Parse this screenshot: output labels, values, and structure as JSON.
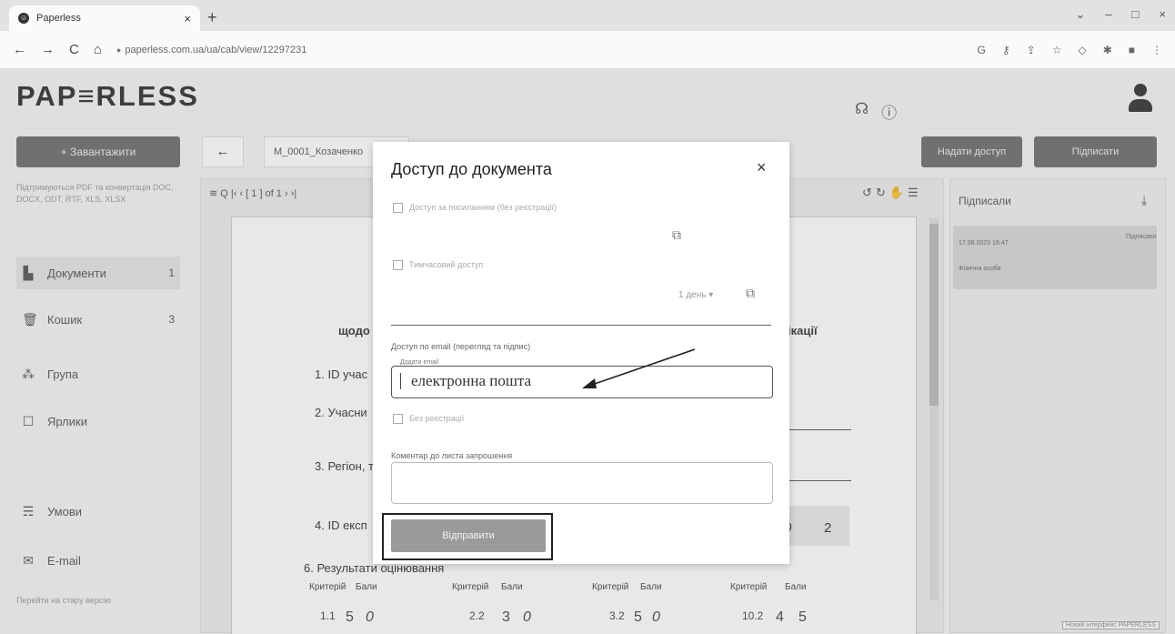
{
  "browser": {
    "tab_title": "Paperless",
    "tab_favicon": "paperless-favicon",
    "tab_close": "×",
    "new_tab": "+",
    "url": "paperless.com.ua/ua/cab/view/12297231",
    "nav": {
      "back": "←",
      "forward": "→",
      "reload": "C",
      "home": "⌂"
    },
    "window_controls": [
      "⌄",
      "–",
      "□",
      "×"
    ]
  },
  "app": {
    "logo": "PAP≡RLESS",
    "upload_button": "+ Завантажити",
    "upload_hint": "Підтримуються PDF та конвертація DOC, DOCX, ODT, RTF, XLS, XLSX",
    "sidebar": [
      {
        "label": "Документи",
        "count": "1",
        "icon": "documents-icon",
        "glyph": "▙"
      },
      {
        "label": "Кошик",
        "count": "3",
        "icon": "trash-icon",
        "glyph": "🗑"
      },
      {
        "label": "Група",
        "count": "",
        "icon": "group-icon",
        "glyph": "⁂"
      },
      {
        "label": "Ярлики",
        "count": "",
        "icon": "label-icon",
        "glyph": "☐"
      },
      {
        "label": "Умови",
        "count": "",
        "icon": "terms-icon",
        "glyph": "☴"
      },
      {
        "label": "E-mail",
        "count": "",
        "icon": "mail-icon",
        "glyph": "✉"
      }
    ],
    "old_version_link": "Перейти на стару версію"
  },
  "toolbar": {
    "back": "←",
    "doc_name": "M_0001_Козаченко",
    "share_button": "Надати доступ",
    "sign_button": "Підписати"
  },
  "viewer": {
    "tools": "≋ Q  |‹  ‹  [ 1 ] of 1  ›  ›|",
    "tools_right": "↺↻✋☰",
    "lines": {
      "heading_left": "щодо",
      "heading_right": "ікації",
      "l1": "1. ID учас",
      "l2": "2. Учасни",
      "l3": "3. Регіон, т",
      "l4": "4. ID експ",
      "l6": "6. Результати оцінювання"
    },
    "score_a": "0",
    "score_b": "2",
    "grade_headers": [
      "Критерій",
      "Бали",
      "Критерій",
      "Бали",
      "Критерій",
      "Бали",
      "Критерій",
      "Бали"
    ],
    "grade_values": [
      "1.1",
      "5",
      "0",
      "2.2",
      "3",
      "0",
      "3.2",
      "5",
      "0",
      "10.2",
      "4",
      "5"
    ]
  },
  "signers": {
    "title": "Підписали",
    "date": "17.08.2023 16:47",
    "status": "Підписано",
    "type": "Фізична особа"
  },
  "modal": {
    "title": "Доступ до документа",
    "close": "×",
    "option1": "Доступ за посиланням (без реєстрації)",
    "option2": "Тимчасовий доступ",
    "days": "1 день",
    "email_section": "Доступ по email (перегляд та підпис)",
    "email_legend": "Додати email",
    "email_value": "електронна пошта",
    "option3": "Без реєстрації",
    "comment_label": "Коментар до листа запрошення",
    "send_button": "Відправити"
  },
  "corner_tag": "Новий інтерфейс PAPERLESS"
}
